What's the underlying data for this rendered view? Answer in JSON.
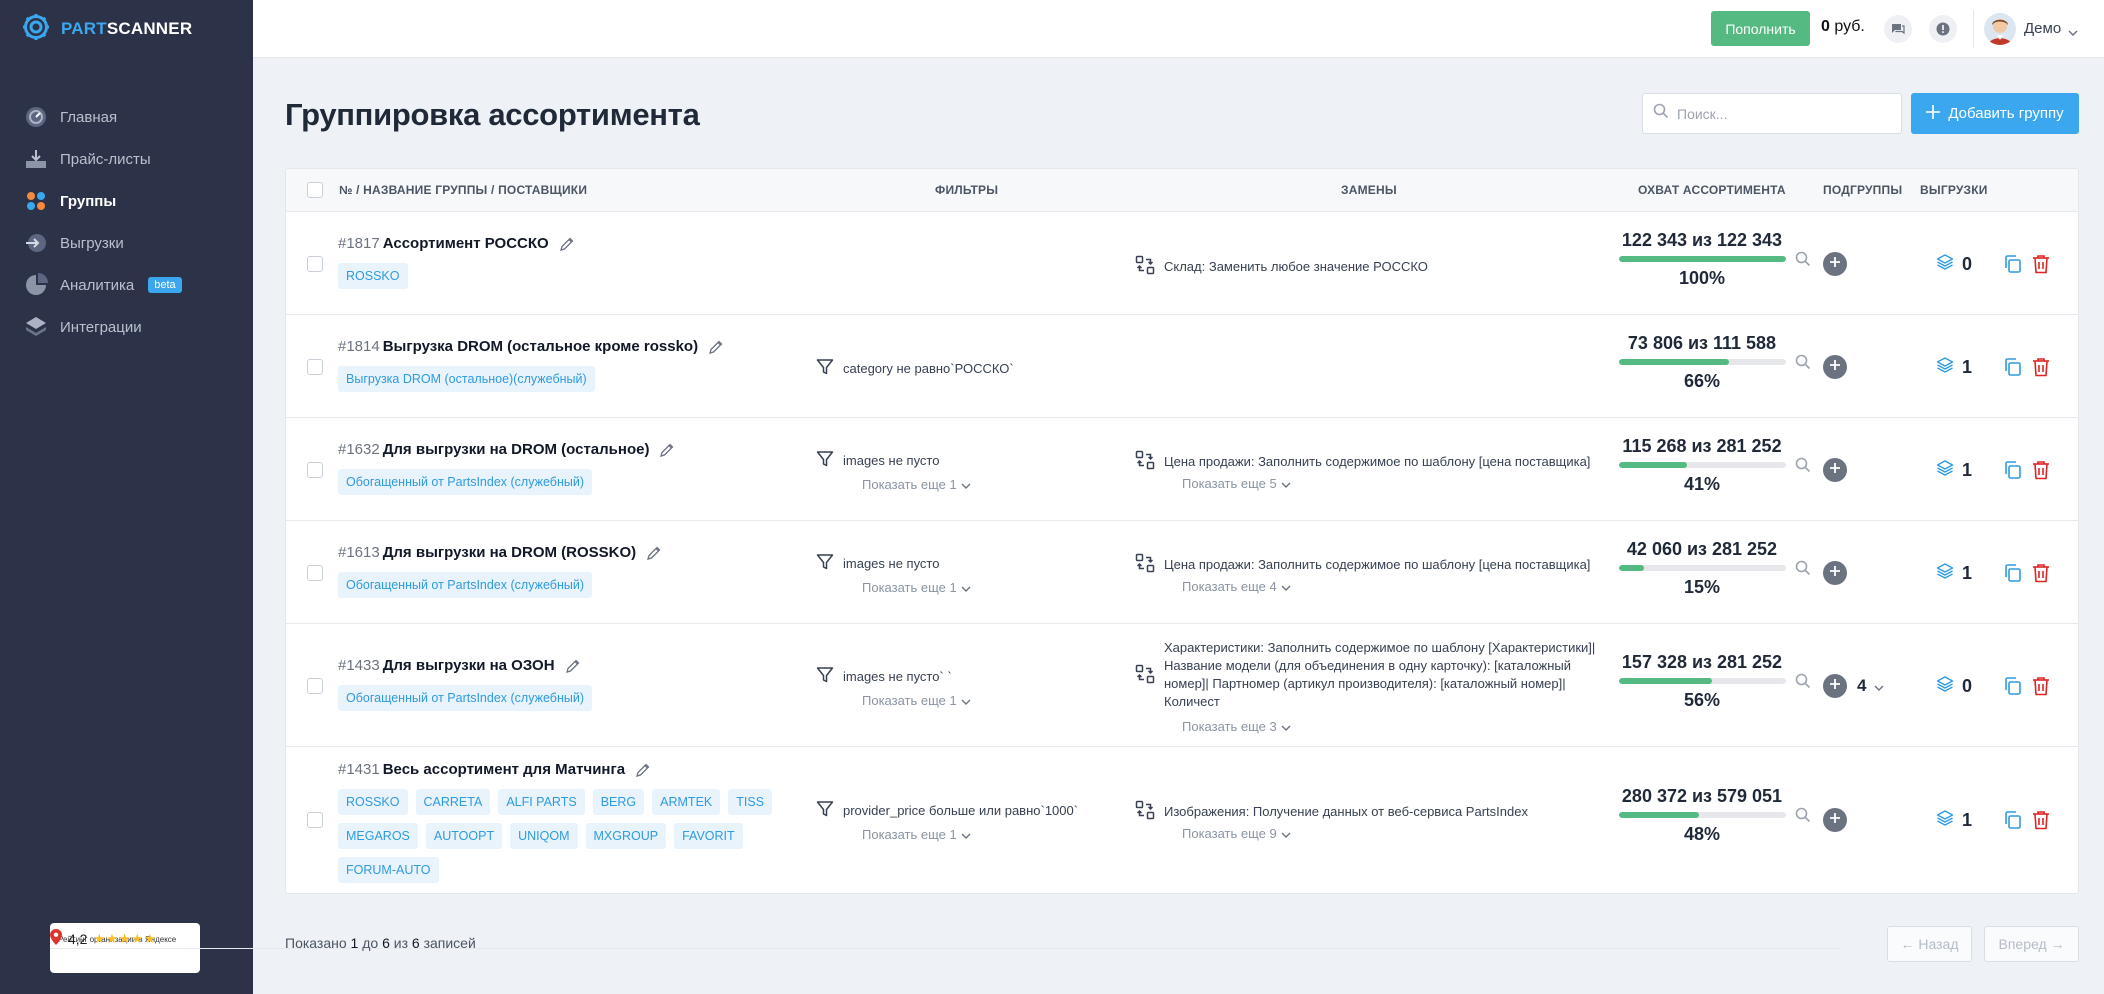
{
  "brand": {
    "part1": "PART",
    "part2": "SCANNER"
  },
  "nav": [
    {
      "label": "Главная",
      "icon": "dashboard-icon"
    },
    {
      "label": "Прайс-листы",
      "icon": "upload-icon"
    },
    {
      "label": "Группы",
      "icon": "groups-icon",
      "active": true
    },
    {
      "label": "Выгрузки",
      "icon": "export-icon"
    },
    {
      "label": "Аналитика",
      "icon": "analytics-icon",
      "badge": "beta"
    },
    {
      "label": "Интеграции",
      "icon": "layers-icon"
    }
  ],
  "rating": {
    "value": "4,2",
    "stars": "★★★★★",
    "caption": "Рейтинг организации в Яндексе"
  },
  "topbar": {
    "topup_label": "Пополнить",
    "balance_value": "0",
    "balance_unit": "руб.",
    "user_name": "Демо"
  },
  "page": {
    "title": "Группировка ассортимента",
    "search_placeholder": "Поиск...",
    "add_group_label": "Добавить группу"
  },
  "columns": {
    "name": "№ / НАЗВАНИЕ ГРУППЫ / ПОСТАВЩИКИ",
    "filters": "ФИЛЬТРЫ",
    "replacements": "ЗАМЕНЫ",
    "coverage": "ОХВАТ АССОРТИМЕНТА",
    "subgroups": "ПОДГРУППЫ",
    "exports": "ВЫГРУЗКИ"
  },
  "rows": [
    {
      "id": "#1817",
      "name": "Ассортимент РОССКО",
      "tags": [
        "ROSSKO"
      ],
      "filter": "",
      "filter_more": "",
      "replacement": "Склад: Заменить любое значение РОССКО",
      "replacement_more": "",
      "coverage": "122 343 из 122 343",
      "percent": "100%",
      "fill": 1.0,
      "subgroups": "",
      "exports": "0"
    },
    {
      "id": "#1814",
      "name": "Выгрузка DROM (остальное кроме rossko)",
      "tags": [
        "Выгрузка DROM (остальное)(служебный)"
      ],
      "filter": "category не равно`РОССКО`",
      "filter_more": "",
      "replacement": "",
      "replacement_more": "",
      "coverage": "73 806 из 111 588",
      "percent": "66%",
      "fill": 0.66,
      "subgroups": "",
      "exports": "1"
    },
    {
      "id": "#1632",
      "name": "Для выгрузки на DROM (остальное)",
      "tags": [
        "Обогащенный от PartsIndex (служебный)"
      ],
      "filter": "images не пусто",
      "filter_more": "Показать еще 1",
      "replacement": "Цена продажи: Заполнить содержимое по шаблону [цена поставщика]",
      "replacement_more": "Показать еще 5",
      "coverage": "115 268 из 281 252",
      "percent": "41%",
      "fill": 0.41,
      "subgroups": "",
      "exports": "1"
    },
    {
      "id": "#1613",
      "name": "Для выгрузки на DROM (ROSSKO)",
      "tags": [
        "Обогащенный от PartsIndex (служебный)"
      ],
      "filter": "images не пусто",
      "filter_more": "Показать еще 1",
      "replacement": "Цена продажи: Заполнить содержимое по шаблону [цена поставщика]",
      "replacement_more": "Показать еще 4",
      "coverage": "42 060 из 281 252",
      "percent": "15%",
      "fill": 0.15,
      "subgroups": "",
      "exports": "1"
    },
    {
      "id": "#1433",
      "name": "Для выгрузки на ОЗОН",
      "tags": [
        "Обогащенный от PartsIndex (служебный)"
      ],
      "filter": "images не пусто` `",
      "filter_more": "Показать еще 1",
      "replacement": "Характеристики: Заполнить содержимое по шаблону [Характеристики]| Название модели (для объединения в одну карточку): [каталожный номер]| Партномер (артикул производителя): [каталожный номер]| Количест",
      "replacement_more": "Показать еще 3",
      "coverage": "157 328 из 281 252",
      "percent": "56%",
      "fill": 0.56,
      "subgroups": "4",
      "exports": "0"
    },
    {
      "id": "#1431",
      "name": "Весь ассортимент для Матчинга",
      "tags": [
        "ROSSKO",
        "CARRETA",
        "ALFI PARTS",
        "BERG",
        "ARMTEK",
        "TISS",
        "MEGAROS",
        "AUTOOPT",
        "UNIQOM",
        "MXGROUP",
        "FAVORIT",
        "FORUM-AUTO"
      ],
      "filter": "provider_price больше или равно`1000`",
      "filter_more": "Показать еще 1",
      "replacement": "Изображения: Получение данных от веб-сервиса PartsIndex",
      "replacement_more": "Показать еще 9",
      "coverage": "280 372 из 579 051",
      "percent": "48%",
      "fill": 0.48,
      "subgroups": "",
      "exports": "1"
    }
  ],
  "footer": {
    "p1": "Показано ",
    "from": "1",
    "p2": " до ",
    "to": "6",
    "p3": " из ",
    "total": "6",
    "p4": " записей",
    "prev": "← Назад",
    "next": "Вперед →"
  },
  "colors": {
    "sidebar": "#2c3348",
    "accent": "#3ba7ef",
    "success": "#55b982",
    "danger": "#e02424"
  }
}
